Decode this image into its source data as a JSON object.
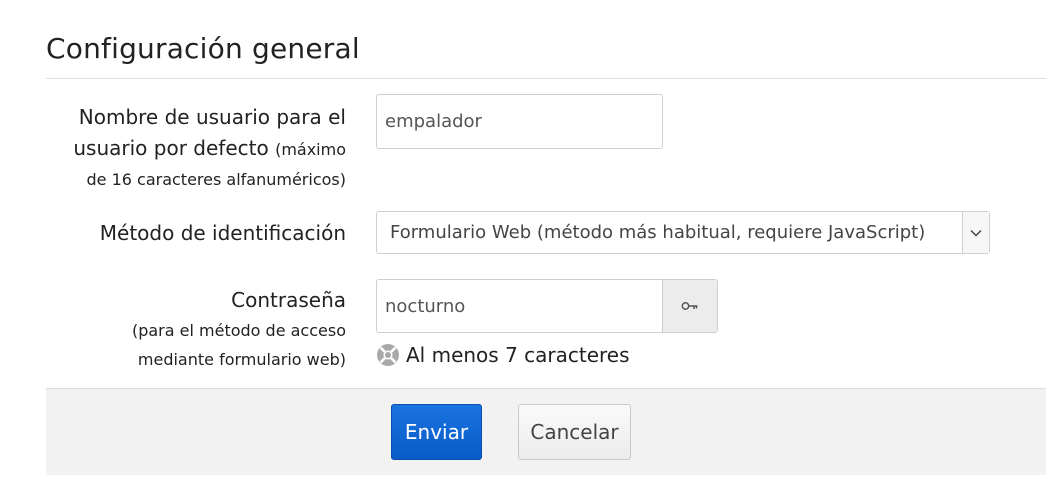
{
  "section": {
    "title": "Configuración general"
  },
  "fields": {
    "username": {
      "label_line1": "Nombre de usuario para el",
      "label_line2": "usuario por defecto",
      "label_small_a": "(máximo",
      "label_small_b": "de 16 caracteres alfanuméricos)",
      "value": "empalador"
    },
    "auth_method": {
      "label": "Método de identificación",
      "selected": "Formulario Web (método más habitual, requiere JavaScript)",
      "icon": "chevron-down-icon"
    },
    "password": {
      "label": "Contraseña",
      "label_small_a": "(para el método de acceso",
      "label_small_b": "mediante formulario web)",
      "value": "nocturno",
      "toggle_icon": "key-icon",
      "hint": "Al menos 7 caracteres",
      "hint_icon": "lifebuoy-icon"
    }
  },
  "actions": {
    "submit_label": "Enviar",
    "cancel_label": "Cancelar"
  },
  "colors": {
    "primary": "#0a5bc7",
    "footer_bg": "#f2f2f2"
  }
}
